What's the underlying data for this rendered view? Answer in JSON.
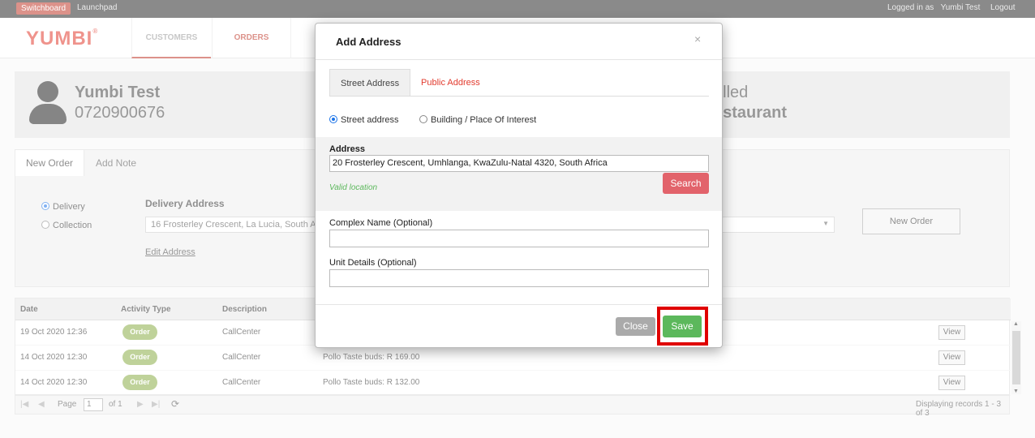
{
  "topbar": {
    "switchboard": "Switchboard",
    "launchpad": "Launchpad",
    "logged_in_as": "Logged in as",
    "user": "Yumbi Test",
    "logout": "Logout"
  },
  "header": {
    "logo": "YUMBI",
    "logo_mark": "®",
    "nav": {
      "customers": "CUSTOMERS",
      "orders": "ORDERS"
    }
  },
  "customer": {
    "name": "Yumbi Test",
    "phone": "0720900676",
    "called_partial": "alled",
    "restaurant_partial": "estaurant"
  },
  "order": {
    "tabs": {
      "new_order": "New Order",
      "add_note": "Add Note"
    },
    "delivery": "Delivery",
    "collection": "Collection",
    "delivery_address_title": "Delivery Address",
    "delivery_address_value": "16 Frosterley Crescent, La Lucia, South A",
    "edit_address": "Edit Address",
    "new_order_button": "New Order"
  },
  "table": {
    "headers": {
      "date": "Date",
      "activity_type": "Activity Type",
      "description": "Description"
    },
    "rows": [
      {
        "date": "19 Oct 2020 12:36",
        "type": "Order",
        "description": "CallCenter",
        "detail": "",
        "view": "View"
      },
      {
        "date": "14 Oct 2020 12:30",
        "type": "Order",
        "description": "CallCenter",
        "detail": "Pollo Taste buds: R 169.00",
        "view": "View"
      },
      {
        "date": "14 Oct 2020 12:30",
        "type": "Order",
        "description": "CallCenter",
        "detail": "Pollo Taste buds: R 132.00",
        "view": "View"
      }
    ]
  },
  "pager": {
    "first": "|◀",
    "prev": "◀",
    "page_label": "Page",
    "page": "1",
    "of_label": "of 1",
    "next": "▶",
    "last": "▶|",
    "refresh": "⟳",
    "records": "Displaying records 1 - 3 of 3"
  },
  "modal": {
    "title": "Add Address",
    "close_x": "×",
    "tabs": {
      "street": "Street Address",
      "public": "Public Address"
    },
    "radio_street": "Street address",
    "radio_building": "Building / Place Of Interest",
    "address_label": "Address",
    "address_value": "20 Frosterley Crescent, Umhlanga, KwaZulu-Natal 4320, South Africa",
    "valid_text": "Valid location",
    "search_button": "Search",
    "complex_label": "Complex Name (Optional)",
    "unit_label": "Unit Details (Optional)",
    "close_button": "Close",
    "save_button": "Save"
  },
  "colors": {
    "brand": "#e23b2e",
    "save": "#5cb85c",
    "search": "#e2636b",
    "highlight": "#e00000",
    "badge": "#8bae47"
  }
}
